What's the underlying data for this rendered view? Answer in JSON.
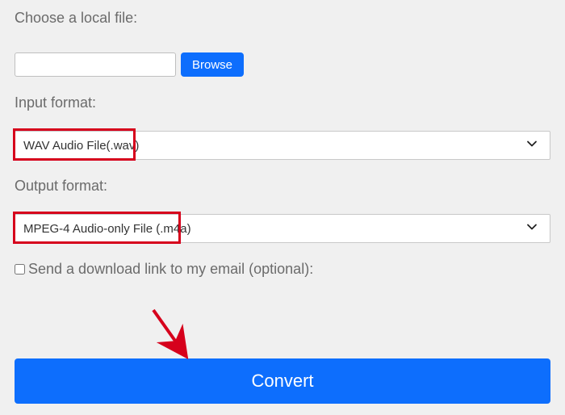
{
  "choose_label": "Choose a local file:",
  "file_value": "",
  "browse_label": "Browse",
  "input_format_label": "Input format:",
  "input_format_value": "WAV Audio File(.wav)",
  "output_format_label": "Output format:",
  "output_format_value": "MPEG-4 Audio-only File (.m4a)",
  "email_label": "Send a download link to my email (optional):",
  "convert_label": "Convert"
}
